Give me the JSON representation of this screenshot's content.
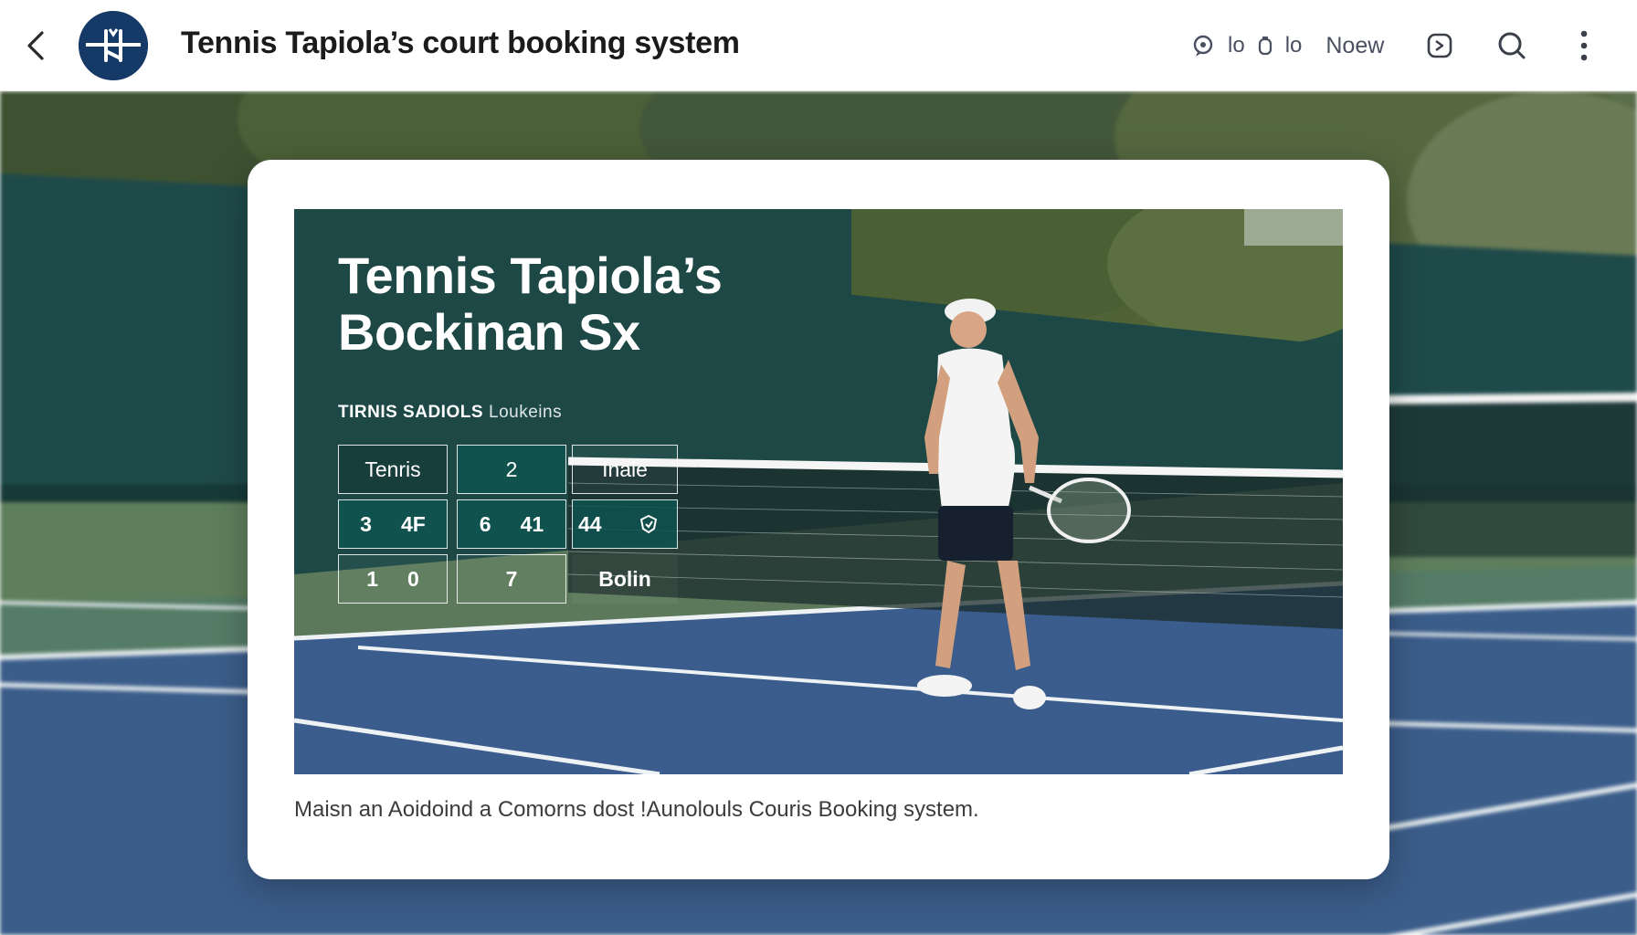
{
  "header": {
    "title": "Tennis Tapiola’s court booking system",
    "status_text_1": "lo",
    "status_text_2": "lo",
    "now_label": "Noew"
  },
  "card": {
    "hero_title_line1": "Tennis Tapiola’s",
    "hero_title_line2": "Bockinan Sx",
    "hero_subtitle_strong": "TIRNIS SADIOLS",
    "hero_subtitle_light": "Loukeins",
    "grid": {
      "r1c1": "Tenris",
      "r1c2": "2",
      "r1c3": "Inale",
      "r2c1_a": "3",
      "r2c1_b": "4F",
      "r2c2_a": "6",
      "r2c2_b": "41",
      "r2c3": "44",
      "r3c1_a": "1",
      "r3c1_b": "0",
      "r3c2": "7",
      "r3c3": "Bolin"
    },
    "caption": "Maisn an Aoidoind a Comorns dost !Aunolouls Couris Booking system."
  },
  "colors": {
    "logo_bg": "#163a68",
    "court_blue": "#3d5f8e",
    "court_green": "#5e7f5f",
    "windscreen": "#1e4a48",
    "cell_teal": "#0e5450"
  }
}
